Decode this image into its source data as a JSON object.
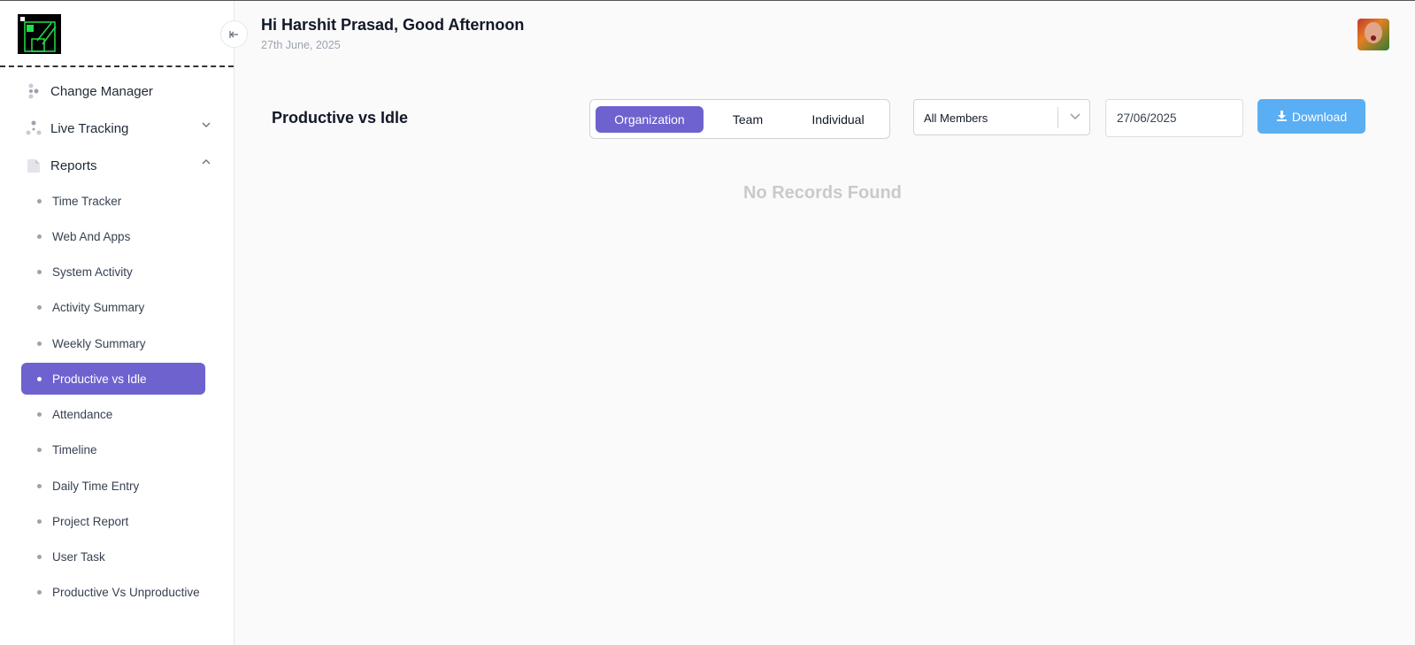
{
  "header": {
    "greeting": "Hi Harshit Prasad, Good Afternoon",
    "date": "27th June, 2025"
  },
  "sidebar": {
    "menu": [
      {
        "label": "Change Manager",
        "icon": "people-icon"
      },
      {
        "label": "Live Tracking",
        "icon": "network-icon"
      },
      {
        "label": "Reports",
        "icon": "file-icon"
      }
    ],
    "report_items": [
      "Time Tracker",
      "Web And Apps",
      "System Activity",
      "Activity Summary",
      "Weekly Summary",
      "Productive vs Idle",
      "Attendance",
      "Timeline",
      "Daily Time Entry",
      "Project Report",
      "User Task",
      "Productive Vs Unproductive"
    ],
    "active_item": "Productive vs Idle"
  },
  "main": {
    "title": "Productive vs Idle",
    "segments": [
      "Organization",
      "Team",
      "Individual"
    ],
    "active_segment": "Organization",
    "member_select": "All Members",
    "date_value": "27/06/2025",
    "download_label": "Download",
    "empty_message": "No Records Found"
  },
  "colors": {
    "accent": "#6e62cf",
    "download": "#5aaef3"
  }
}
